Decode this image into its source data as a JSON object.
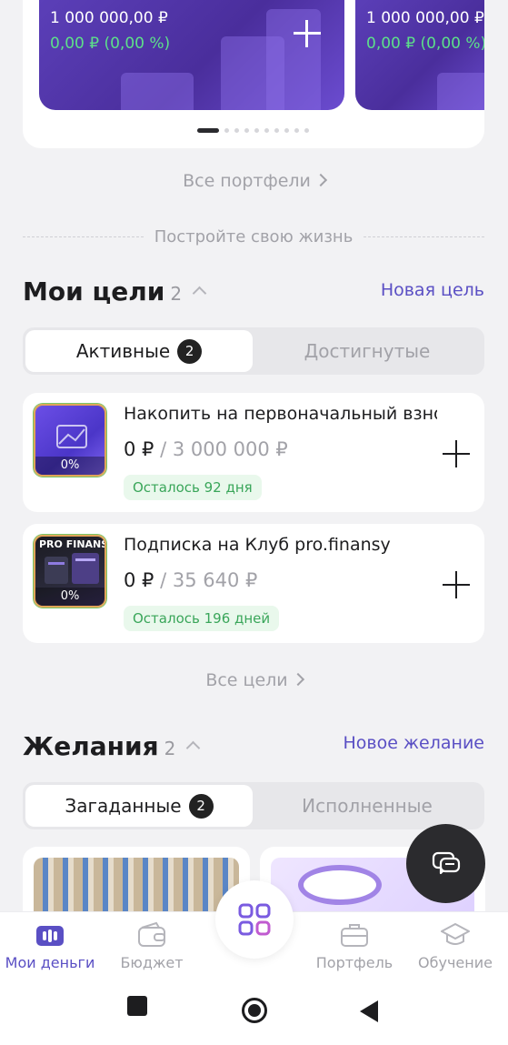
{
  "portfolios": {
    "cards": [
      {
        "amount": "1 000 000,00 ₽",
        "change": "0,00 ₽ (0,00 %)"
      },
      {
        "amount": "1 000 000,00 ₽",
        "change": "0,00 ₽ (0,00 %)"
      }
    ],
    "all_link": "Все портфели"
  },
  "divider_text": "Постройте свою жизнь",
  "goals": {
    "title": "Мои цели",
    "count": "2",
    "action": "Новая цель",
    "tab_active": "Активные",
    "tab_active_badge": "2",
    "tab_inactive": "Достигнутые",
    "items": [
      {
        "title": "Накопить на первоначальный взнос",
        "current": "0 ₽",
        "target": "3 000 000 ₽",
        "left": "Осталось 92 дня",
        "percent": "0%"
      },
      {
        "title": "Подписка на Клуб pro.finansy",
        "current": "0 ₽",
        "target": "35 640 ₽",
        "left": "Осталось 196 дней",
        "percent": "0%",
        "brand": "PRO FINANSY"
      }
    ],
    "all_link": "Все цели"
  },
  "wishes": {
    "title": "Желания",
    "count": "2",
    "action": "Новое желание",
    "tab_active": "Загаданные",
    "tab_active_badge": "2",
    "tab_inactive": "Исполненные"
  },
  "nav": {
    "items": [
      {
        "label": "Мои деньги",
        "icon": "wallet-money-icon"
      },
      {
        "label": "Бюджет",
        "icon": "budget-wallet-icon"
      },
      {
        "label": "Портфель",
        "icon": "briefcase-icon"
      },
      {
        "label": "Обучение",
        "icon": "graduation-cap-icon"
      }
    ]
  },
  "colors": {
    "accent": "#5a4fc4",
    "card": "#4a2e9c",
    "positive": "#3aa65a"
  }
}
